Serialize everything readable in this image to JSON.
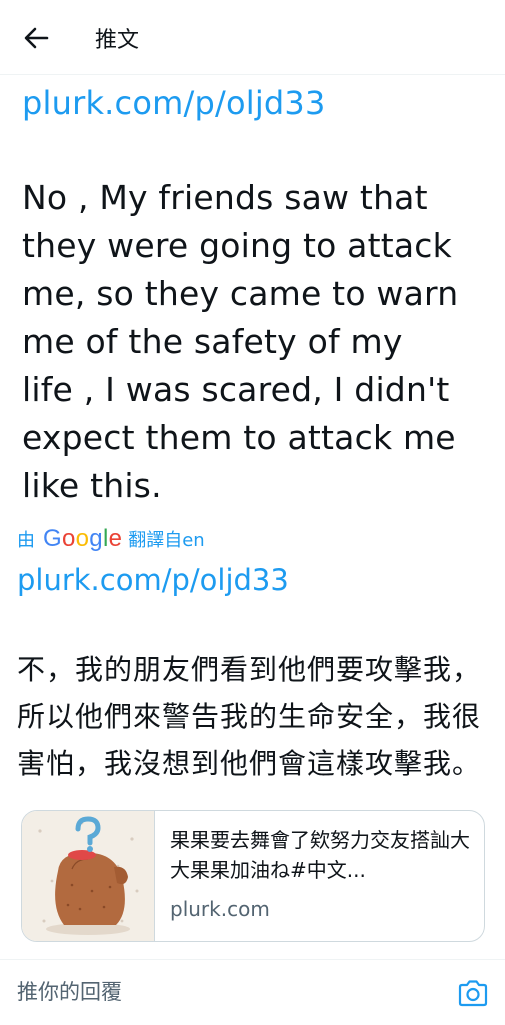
{
  "header": {
    "title": "推文"
  },
  "tweet": {
    "link": "plurk.com/p/oljd33",
    "text": "No , My friends saw that\nthey were going to attack\nme, so they came to warn\nme of the safety of my\nlife , I was scared, I didn't\nexpect them to attack me\nlike this."
  },
  "translation": {
    "by_label": "由",
    "google_logo": "Google",
    "from_label": "翻譯自en",
    "link": "plurk.com/p/oljd33",
    "text": "不，我的朋友們看到他們要攻擊我，所以他們來警告我的生命安全，我很害怕，我沒想到他們會這樣攻擊我。"
  },
  "card": {
    "title": "果果要去舞會了欸努力交友搭訕大大果果加油ね#中文...",
    "domain": "plurk.com"
  },
  "reply": {
    "placeholder": "推你的回覆"
  },
  "colors": {
    "accent": "#1d9bf0",
    "text": "#0f1419",
    "secondary": "#536471",
    "border": "#cfd9de"
  }
}
